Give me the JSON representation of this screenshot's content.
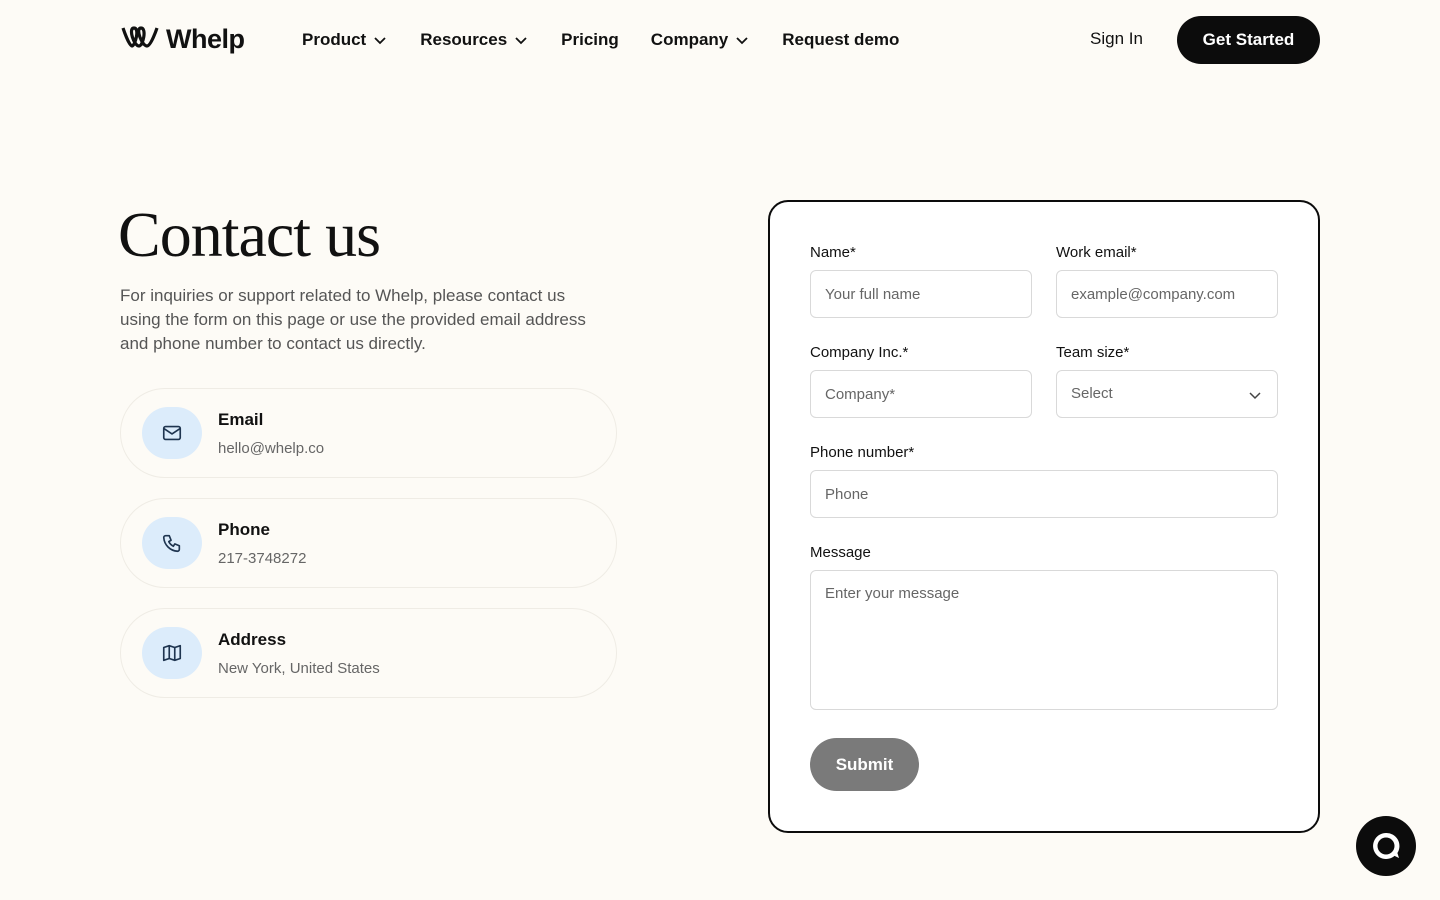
{
  "brand": {
    "name": "Whelp",
    "logo_icon": "whelp-logo-icon"
  },
  "nav": {
    "items": [
      {
        "label": "Product",
        "has_dropdown": true
      },
      {
        "label": "Resources",
        "has_dropdown": true
      },
      {
        "label": "Pricing",
        "has_dropdown": false
      },
      {
        "label": "Company",
        "has_dropdown": true
      },
      {
        "label": "Request demo",
        "has_dropdown": false
      }
    ],
    "signin_label": "Sign In",
    "cta_label": "Get Started"
  },
  "hero": {
    "title": "Contact us",
    "description": "For inquiries or support related to Whelp, please contact us using the form on this page or use the provided email address and phone number to contact us directly."
  },
  "contacts": [
    {
      "label": "Email",
      "value": "hello@whelp.co",
      "icon": "mail-icon"
    },
    {
      "label": "Phone",
      "value": "217-3748272",
      "icon": "phone-icon"
    },
    {
      "label": "Address",
      "value": "New York, United States",
      "icon": "map-icon"
    }
  ],
  "form": {
    "name_label": "Name*",
    "name_placeholder": "Your full name",
    "email_label": "Work email*",
    "email_placeholder": "example@company.com",
    "company_label": "Company Inc.*",
    "company_placeholder": "Company*",
    "team_size_label": "Team size*",
    "team_size_value": "Select",
    "phone_label": "Phone number*",
    "phone_placeholder": "Phone",
    "message_label": "Message",
    "message_placeholder": "Enter your message",
    "submit_label": "Submit"
  },
  "chat": {
    "icon": "chat-bubble-icon"
  },
  "colors": {
    "background": "#fdfbf6",
    "primary": "#0c0c0c",
    "icon_bg": "#dcecfb",
    "icon_stroke": "#1f3550",
    "submit_disabled": "#7a7a7a"
  }
}
